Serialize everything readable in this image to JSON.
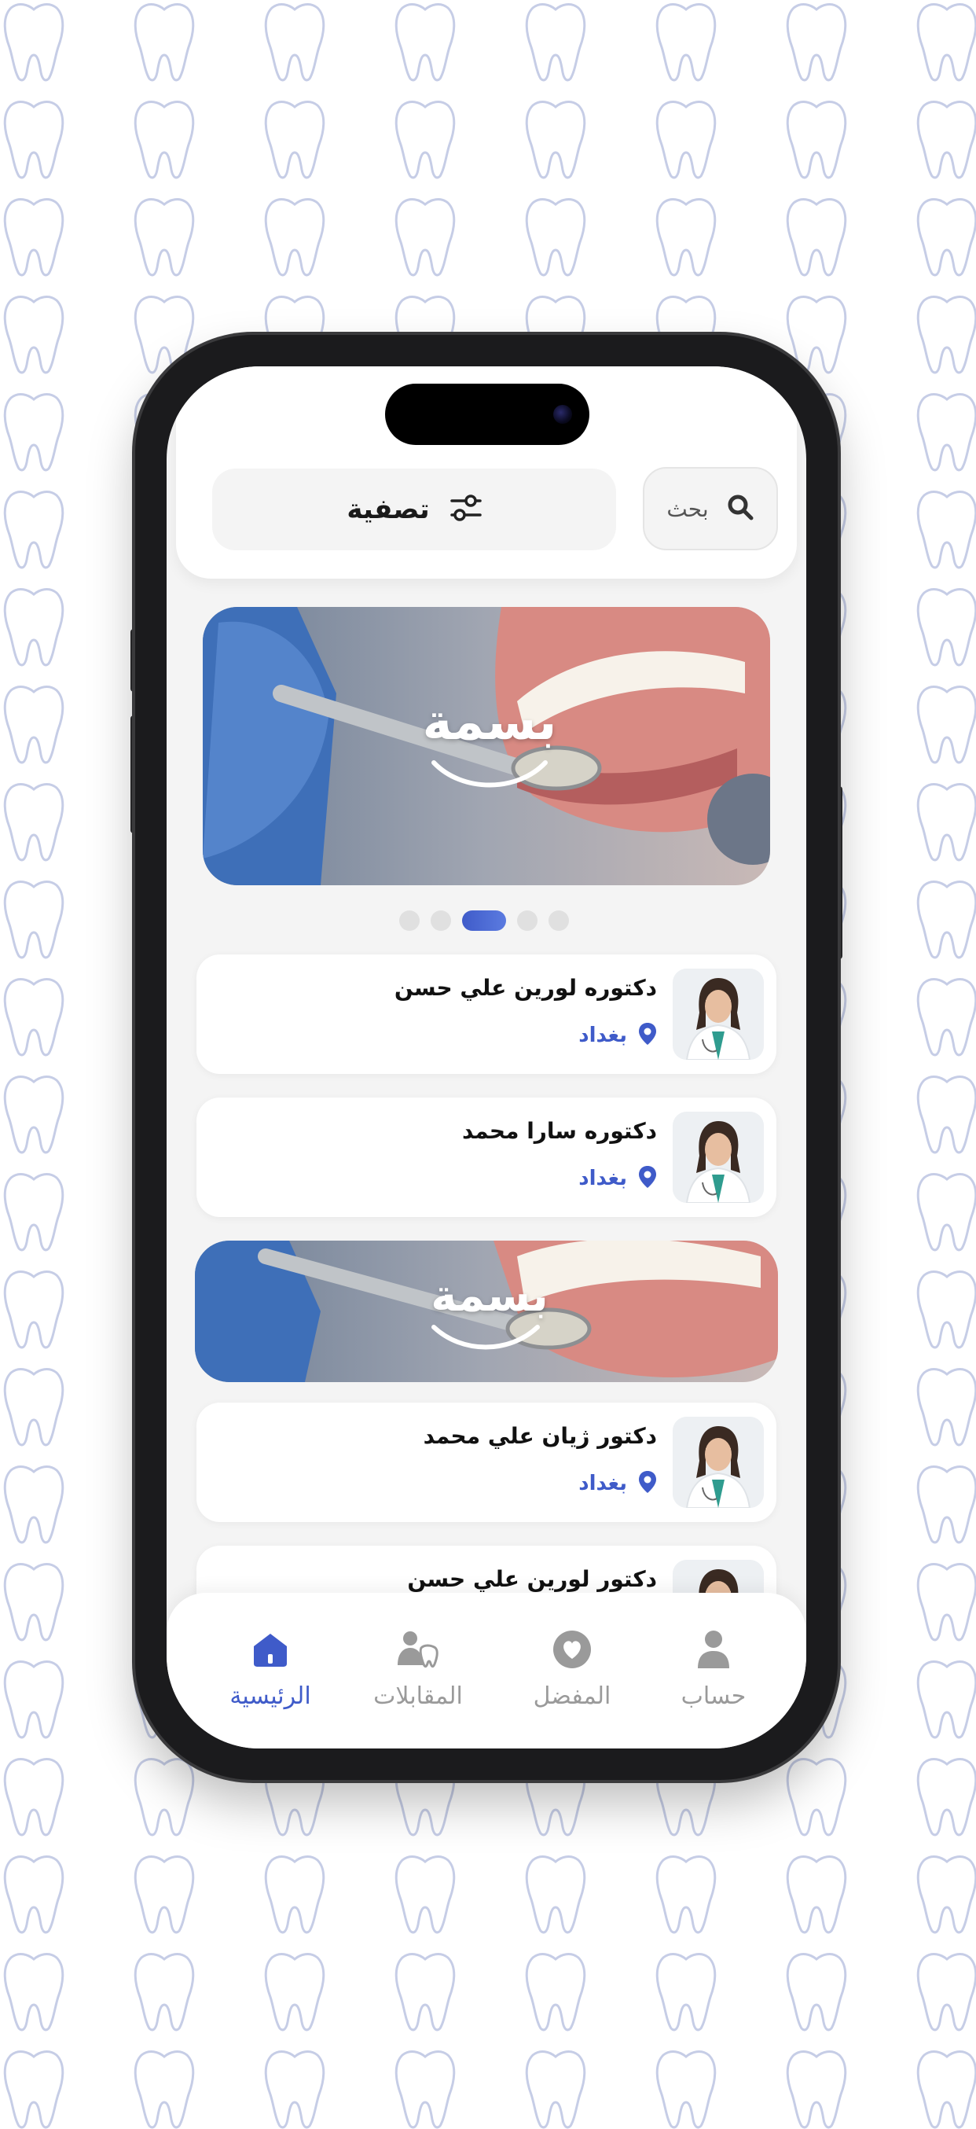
{
  "search": {
    "label": "بحث",
    "icon": "search-icon"
  },
  "filter": {
    "label": "تصفية",
    "icon": "sliders-icon"
  },
  "banners": [
    {
      "brand_text": "بسمة"
    },
    {
      "brand_text": "بسمة"
    }
  ],
  "carousel": {
    "pages": 5,
    "active_index": 2
  },
  "doctors": [
    {
      "name": "دكتوره لورين علي حسن",
      "city": "بغداد"
    },
    {
      "name": "دكتوره سارا محمد",
      "city": "بغداد"
    },
    {
      "name": "دكتور ژيان علي محمد",
      "city": "بغداد"
    },
    {
      "name": "دكتور لورين علي حسن",
      "city": ""
    }
  ],
  "nav": {
    "home": "الرئيسية",
    "interviews": "المقابلات",
    "favorites": "المفضل",
    "account": "حساب"
  },
  "colors": {
    "accent": "#3f5bc9",
    "inactive": "#9a9a9a",
    "background": "#f4f4f4"
  }
}
